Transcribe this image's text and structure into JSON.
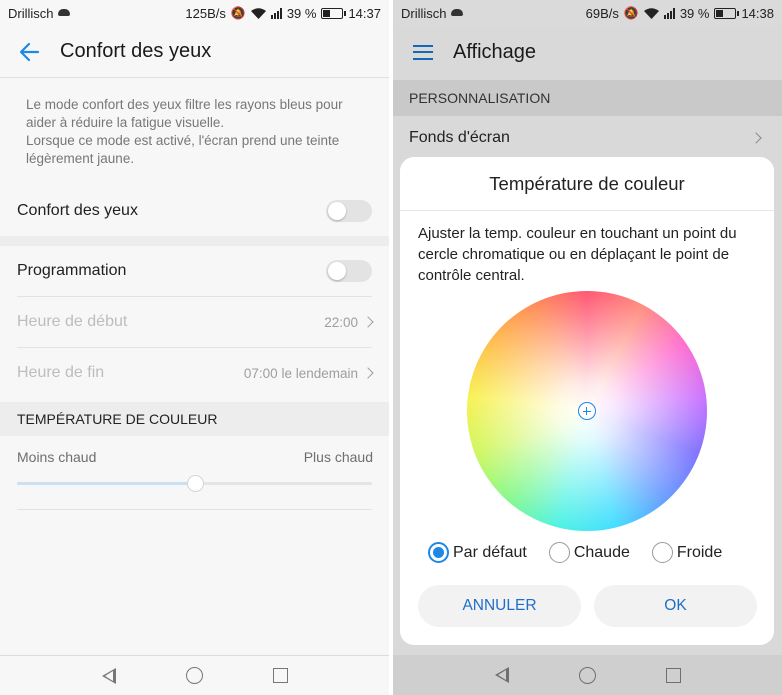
{
  "left": {
    "status": {
      "carrier": "Drillisch",
      "speed": "125B/s",
      "battery": "39 %",
      "time": "14:37"
    },
    "header": {
      "title": "Confort des yeux"
    },
    "description": "Le mode confort des yeux filtre les rayons bleus pour aider à réduire la fatigue visuelle.\nLorsque ce mode est activé, l'écran prend une teinte légèrement jaune.",
    "eye_comfort": {
      "label": "Confort des yeux",
      "enabled": false
    },
    "schedule": {
      "label": "Programmation",
      "enabled": false
    },
    "start_time": {
      "label": "Heure de début",
      "value": "22:00"
    },
    "end_time": {
      "label": "Heure de fin",
      "value": "07:00 le lendemain"
    },
    "color_temp": {
      "section_title": "TEMPÉRATURE DE COULEUR",
      "min_label": "Moins chaud",
      "max_label": "Plus chaud",
      "value": 0.5
    }
  },
  "right": {
    "status": {
      "carrier": "Drillisch",
      "speed": "69B/s",
      "battery": "39 %",
      "time": "14:38"
    },
    "header": {
      "title": "Affichage"
    },
    "section": "PERSONNALISATION",
    "wallpaper_label": "Fonds d'écran",
    "dialog": {
      "title": "Température de couleur",
      "text": "Ajuster la temp. couleur en touchant un point du cercle chromatique ou en déplaçant le point de contrôle central.",
      "options": [
        {
          "label": "Par défaut",
          "selected": true
        },
        {
          "label": "Chaude",
          "selected": false
        },
        {
          "label": "Froide",
          "selected": false
        }
      ],
      "cancel_label": "ANNULER",
      "ok_label": "OK"
    }
  },
  "accent_color": "#1e88e5"
}
